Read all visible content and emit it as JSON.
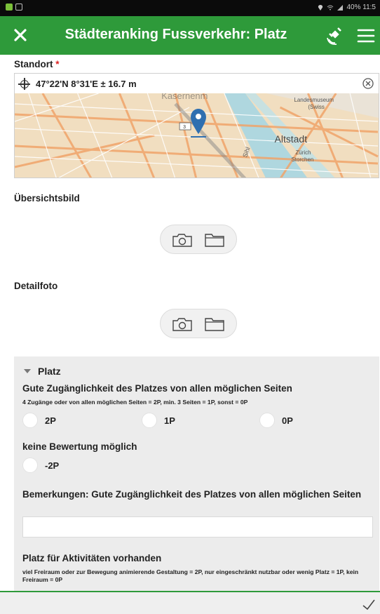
{
  "status_bar": {
    "right_text": "40% 11:5",
    "icons": [
      "notification-icon",
      "image-icon",
      "location-icon",
      "wifi-icon",
      "signal-icon",
      "battery-icon"
    ]
  },
  "app_bar": {
    "title": "Städteranking Fussverkehr: Platz",
    "background": "#2e9a3a",
    "close_icon": "close-icon",
    "gps_icon": "gps-satellite-icon",
    "menu_icon": "hamburger-menu-icon"
  },
  "location": {
    "label": "Standort",
    "required_mark": "*",
    "value": "47°22'N 8°31'E ± 16.7 m",
    "map": {
      "labels": {
        "top": "Kasernenm",
        "museum": "Landesmuseum",
        "museum_sub": "(Swiss",
        "altstadt": "Altstadt",
        "zurich": "Zürich",
        "storchen": "Storchen",
        "sihl": "Sihl",
        "badge": "3"
      }
    }
  },
  "overview_photo": {
    "label": "Übersichtsbild",
    "camera_icon": "camera-icon",
    "folder_icon": "folder-icon"
  },
  "detail_photo": {
    "label": "Detailfoto",
    "camera_icon": "camera-icon",
    "folder_icon": "folder-icon"
  },
  "section": {
    "title": "Platz",
    "q1": {
      "title": "Gute Zugänglichkeit des Platzes von allen möglichen Seiten",
      "hint": "4 Zugänge oder von allen möglichen Seiten = 2P, min. 3 Seiten = 1P, sonst = 0P",
      "options": [
        "2P",
        "1P",
        "0P"
      ]
    },
    "q2": {
      "title": "keine Bewertung möglich",
      "options": [
        "-2P"
      ]
    },
    "remark": {
      "title": "Bemerkungen: Gute Zugänglichkeit des Platzes von allen möglichen Seiten",
      "value": ""
    },
    "q3": {
      "title": "Platz für Aktivitäten vorhanden",
      "hint": "viel Freiraum oder zur Bewegung animierende Gestaltung = 2P, nur eingeschränkt nutzbar oder wenig Platz = 1P, kein Freiraum = 0P"
    }
  },
  "bottom_bar": {
    "submit_icon": "checkmark-icon"
  }
}
